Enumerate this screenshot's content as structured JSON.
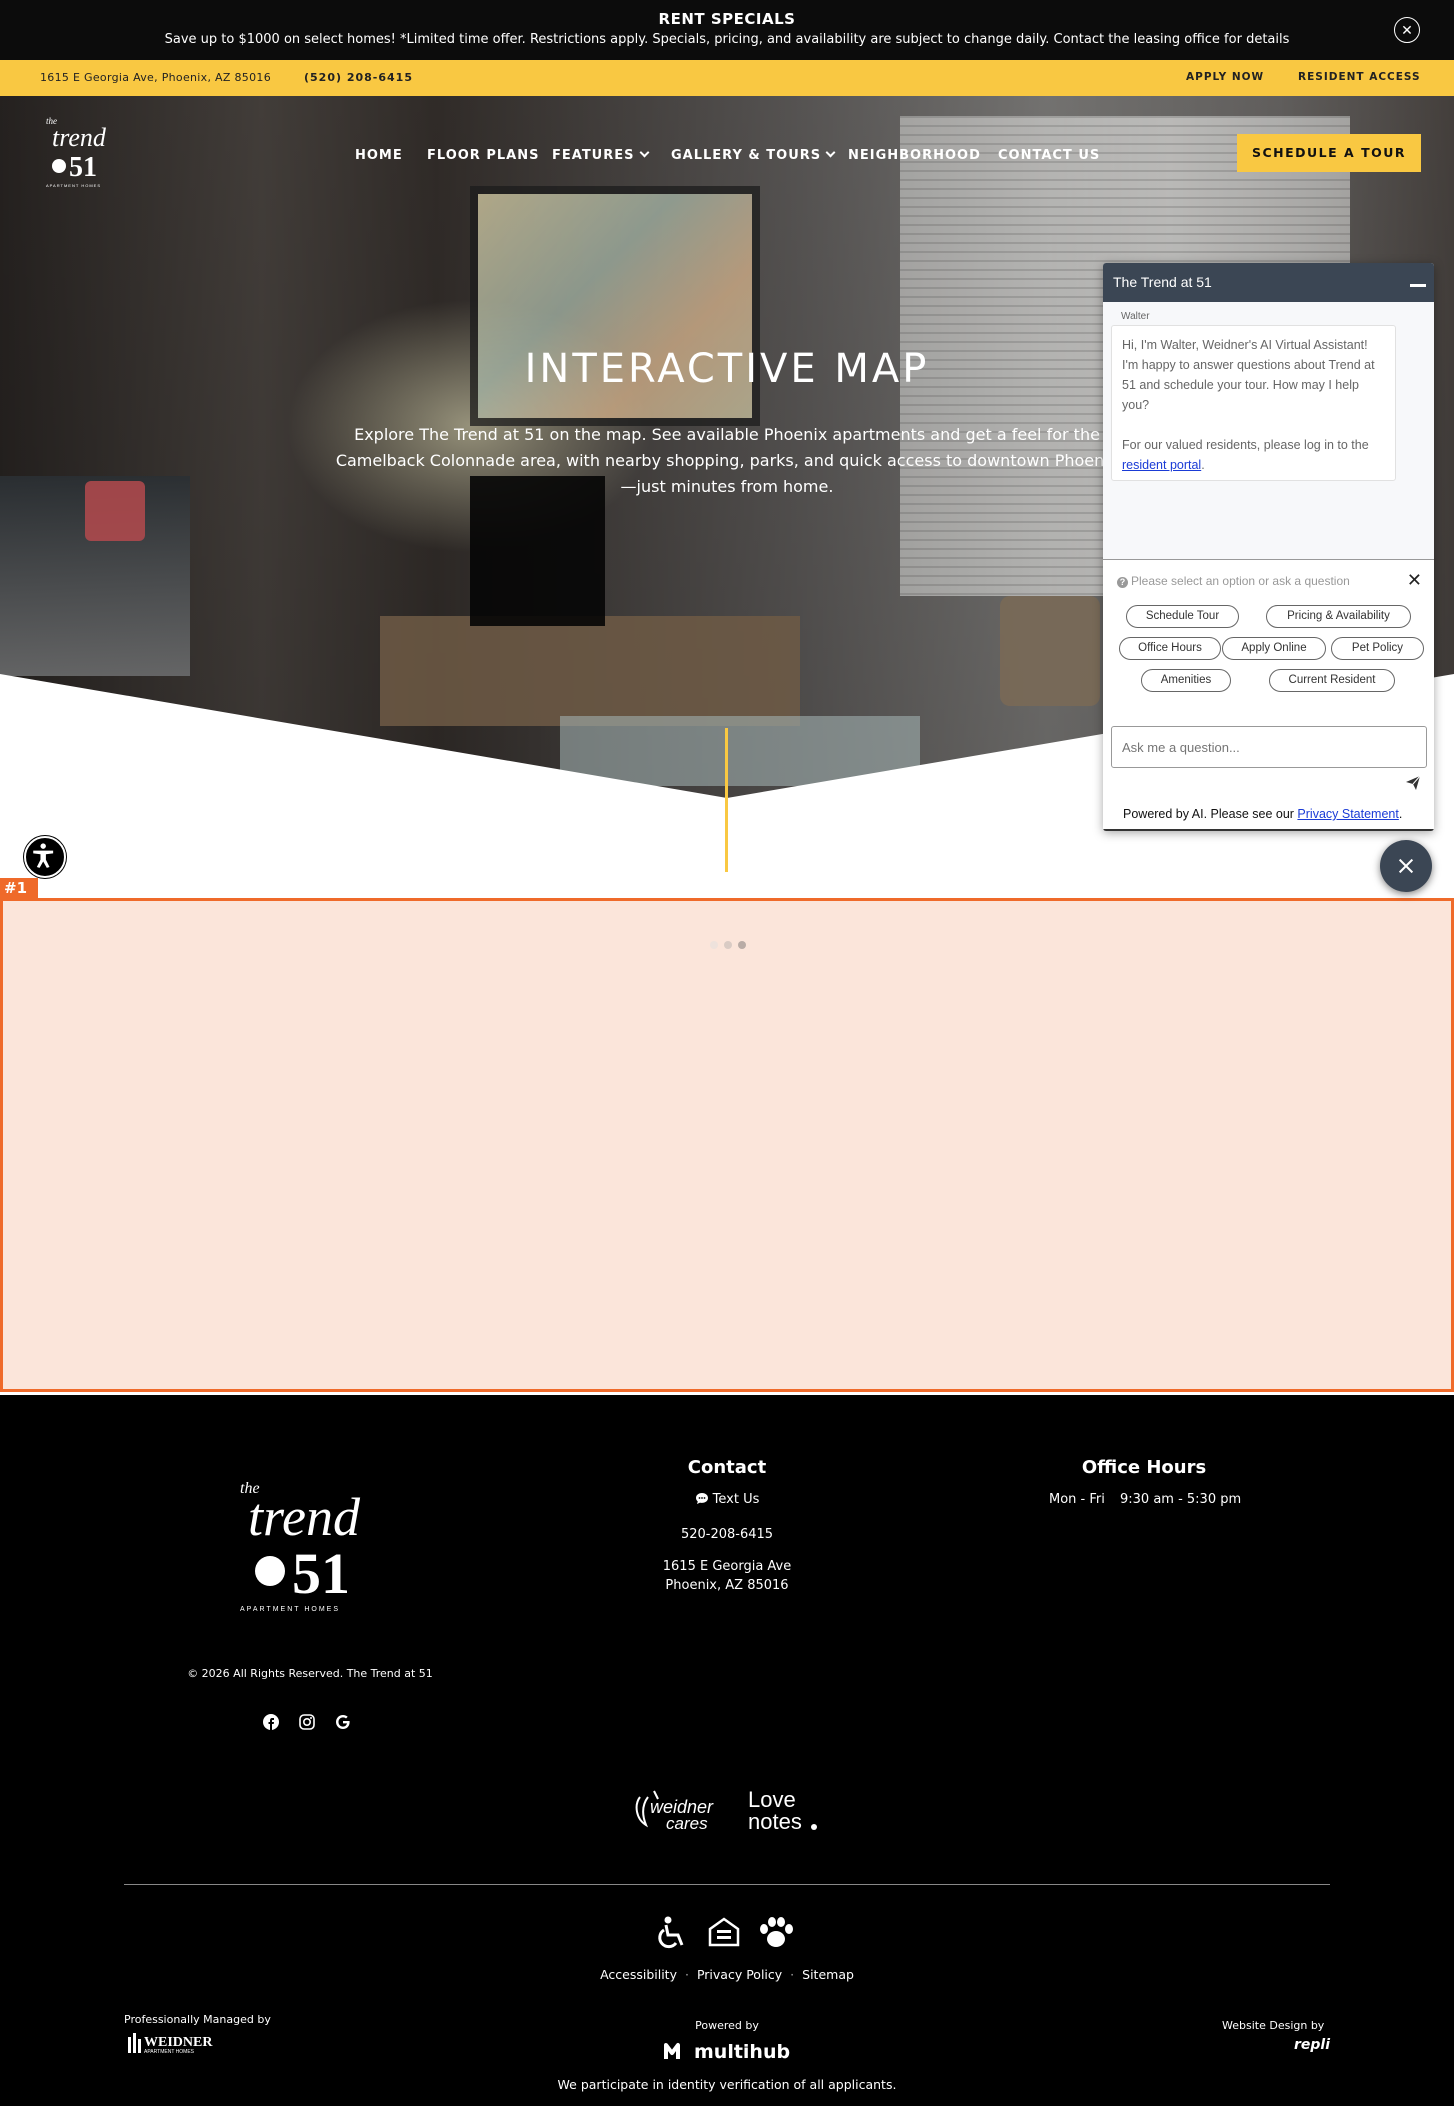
{
  "announcement": {
    "title": "RENT SPECIALS",
    "text": "Save up to $1000 on select homes! *Limited time offer. Restrictions apply. Specials, pricing, and availability are subject to change daily. Contact the leasing office for details",
    "close_icon": "close-icon"
  },
  "utility_bar": {
    "address": "1615 E Georgia Ave, Phoenix, AZ 85016",
    "phone": "(520) 208-6415",
    "apply_label": "APPLY NOW",
    "resident_label": "RESIDENT ACCESS"
  },
  "nav": {
    "logo_small": "the",
    "logo_word": "trend",
    "logo_number": "51",
    "logo_sub": "APARTMENT HOMES",
    "items": [
      "HOME",
      "FLOOR PLANS",
      "FEATURES",
      "GALLERY & TOURS",
      "NEIGHBORHOOD",
      "CONTACT US"
    ],
    "cta": "SCHEDULE A TOUR"
  },
  "hero": {
    "title": "INTERACTIVE MAP",
    "text": "Explore The Trend at 51 on the map. See available Phoenix apartments and get a feel for the Camelback Colonnade area, with nearby shopping, parks, and quick access to downtown Phoenix—just minutes from home."
  },
  "map": {
    "tag": "#1"
  },
  "chat": {
    "title": "The Trend at 51",
    "agent": "Walter",
    "message_1": "Hi, I'm Walter, Weidner's AI Virtual Assistant! I'm happy to answer questions about Trend at 51 and schedule your tour. How may I help you?",
    "message_2": "For our valued residents, please log in to the",
    "message_link": "resident portal",
    "prompt": "Please select an option or ask a question",
    "options": [
      "Schedule Tour",
      "Pricing & Availability",
      "Office Hours",
      "Apply Online",
      "Pet Policy",
      "Amenities",
      "Current Resident"
    ],
    "input_placeholder": "Ask me a question...",
    "footnote": "Powered by AI. Please see our",
    "footnote_link": "Privacy Statement"
  },
  "footer": {
    "copyright": "© 2026 All Rights Reserved. The Trend at 51",
    "contact_heading": "Contact",
    "text_us": "Text Us",
    "phone": "520-208-6415",
    "address_line1": "1615 E Georgia Ave",
    "address_line2": "Phoenix, AZ 85016",
    "hours_heading": "Office Hours",
    "hours_days": "Mon - Fri",
    "hours_time": "9:30 am - 5:30 pm",
    "brand_1": "weidner cares",
    "brand_2_line1": "Love",
    "brand_2_line2": "notes",
    "links": [
      "Accessibility",
      "Privacy Policy",
      "Sitemap"
    ],
    "managed_by": "Professionally Managed by",
    "managed_logo": "WEIDNER",
    "managed_logo_sub": "APARTMENT HOMES",
    "powered_by": "Powered by",
    "powered_logo": "multihub",
    "design_by": "Website Design by",
    "design_logo": "repli",
    "verify": "We participate in identity verification of all applicants."
  },
  "colors": {
    "accent": "#f9c842",
    "chat_header": "#3b4654",
    "map_highlight": "#ef6a2a",
    "map_fill": "#fbe5da"
  }
}
